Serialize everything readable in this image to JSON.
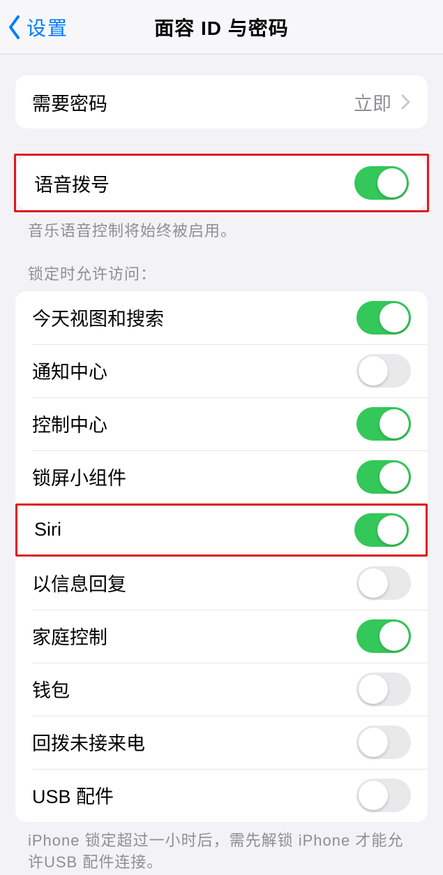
{
  "nav": {
    "back_label": "设置",
    "title": "面容 ID 与密码"
  },
  "require_passcode": {
    "label": "需要密码",
    "value": "立即"
  },
  "voice_dial": {
    "label": "语音拨号",
    "footer": "音乐语音控制将始终被启用。"
  },
  "lock_access": {
    "header": "锁定时允许访问：",
    "items": [
      {
        "label": "今天视图和搜索",
        "on": true
      },
      {
        "label": "通知中心",
        "on": false
      },
      {
        "label": "控制中心",
        "on": true
      },
      {
        "label": "锁屏小组件",
        "on": true
      },
      {
        "label": "Siri",
        "on": true
      },
      {
        "label": "以信息回复",
        "on": false
      },
      {
        "label": "家庭控制",
        "on": true
      },
      {
        "label": "钱包",
        "on": false
      },
      {
        "label": "回拨未接来电",
        "on": false
      },
      {
        "label": "USB 配件",
        "on": false
      }
    ],
    "footer": "iPhone 锁定超过一小时后，需先解锁 iPhone 才能允许USB 配件连接。"
  }
}
